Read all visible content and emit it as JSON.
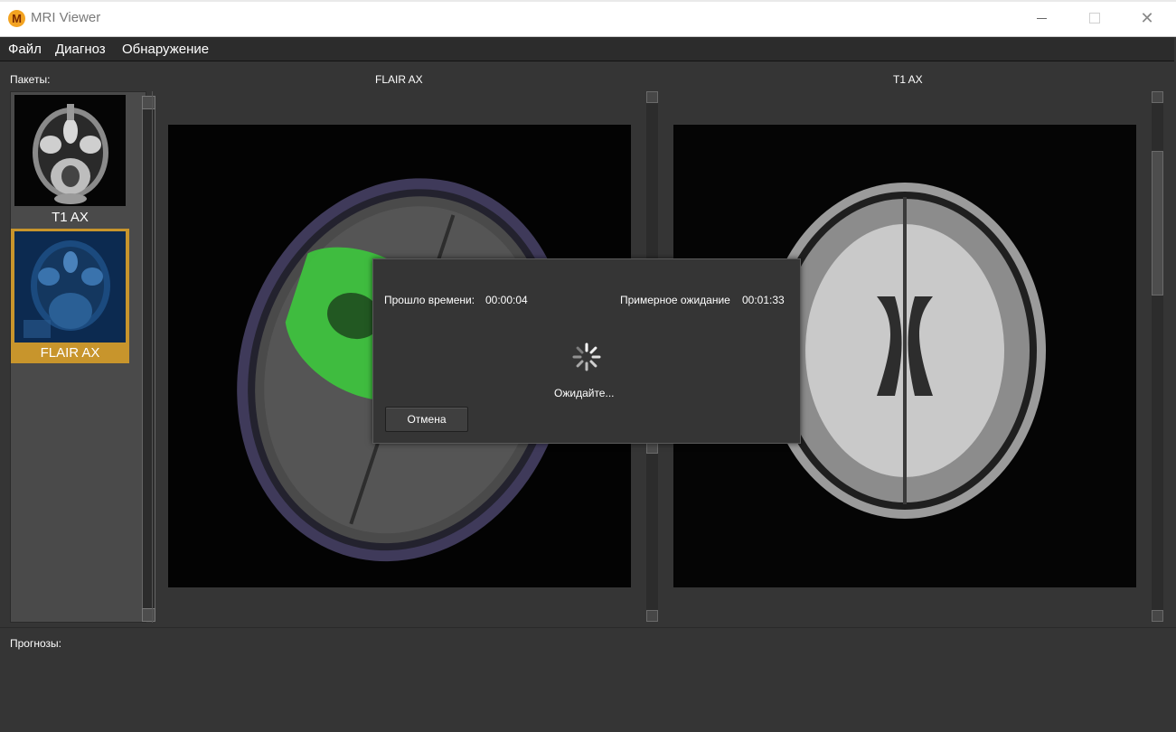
{
  "window": {
    "title": "MRI Viewer",
    "minimize": "—",
    "close": "✕"
  },
  "menu": {
    "items": [
      "Файл",
      "Диагноз",
      "Обнаружение"
    ]
  },
  "packages": {
    "label": "Пакеты:",
    "items": [
      {
        "caption": "T1 AX",
        "selected": false
      },
      {
        "caption": "FLAIR AX",
        "selected": true
      }
    ]
  },
  "viewers": [
    {
      "title": "FLAIR AX"
    },
    {
      "title": "T1 AX"
    }
  ],
  "predictions": {
    "label": "Прогнозы:"
  },
  "dialog": {
    "elapsed_label": "Прошло времени:",
    "elapsed_value": "00:00:04",
    "estimate_label": "Примерное ожидание",
    "estimate_value": "00:01:33",
    "status": "Ожидайте...",
    "cancel_label": "Отмена"
  },
  "colors": {
    "accent": "#c8952c",
    "overlay": "#3ccf3c",
    "background": "#353535"
  }
}
